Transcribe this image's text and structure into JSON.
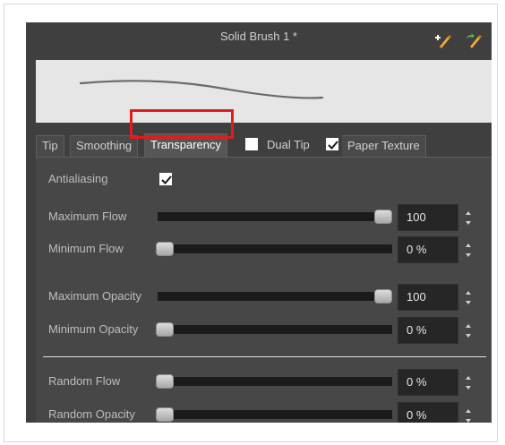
{
  "window": {
    "title": "Solid Brush 1 *"
  },
  "header_icons": [
    "brush-plus-icon",
    "brush-rename-icon"
  ],
  "tabs": [
    {
      "label": "Tip",
      "active": false
    },
    {
      "label": "Smoothing",
      "active": false
    },
    {
      "label": "Transparency",
      "active": true
    },
    {
      "label": "Dual Tip",
      "checkbox": true,
      "checked": false
    },
    {
      "label": "Paper Texture",
      "checkbox": true,
      "checked": true
    }
  ],
  "antialiasing": {
    "label": "Antialiasing",
    "checked": true
  },
  "sliders": [
    {
      "label": "Maximum Flow",
      "value": "100",
      "fraction": 1.0
    },
    {
      "label": "Minimum Flow",
      "value": "0 %",
      "fraction": 0.0
    },
    {
      "label": "Maximum Opacity",
      "value": "100",
      "fraction": 1.0
    },
    {
      "label": "Minimum Opacity",
      "value": "0 %",
      "fraction": 0.0
    },
    {
      "label": "Random Flow",
      "value": "0 %",
      "fraction": 0.0
    },
    {
      "label": "Random Opacity",
      "value": "0 %",
      "fraction": 0.0
    }
  ],
  "colors": {
    "panel": "#3f3f3f",
    "content": "#474747",
    "highlight": "#e21c1c",
    "icon_gold": "#f0a830",
    "icon_green": "#5fb84a"
  }
}
